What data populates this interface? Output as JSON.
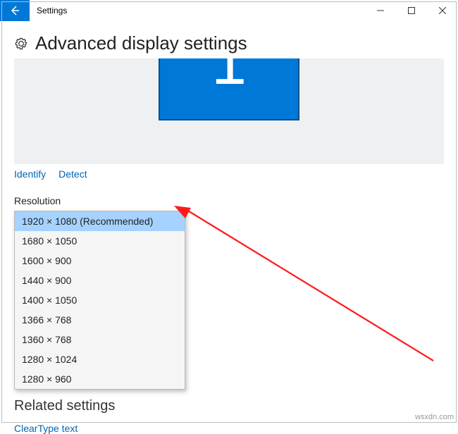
{
  "titlebar": {
    "title": "Settings"
  },
  "page": {
    "heading": "Advanced display settings",
    "monitor_number": "1",
    "identify_label": "Identify",
    "detect_label": "Detect",
    "resolution_label": "Resolution",
    "related_heading": "Related settings",
    "cleartype_label": "ClearType text"
  },
  "resolutions": {
    "items": {
      "0": {
        "label": "1920 × 1080 (Recommended)"
      },
      "1": {
        "label": "1680 × 1050"
      },
      "2": {
        "label": "1600 × 900"
      },
      "3": {
        "label": "1440 × 900"
      },
      "4": {
        "label": "1400 × 1050"
      },
      "5": {
        "label": "1366 × 768"
      },
      "6": {
        "label": "1360 × 768"
      },
      "7": {
        "label": "1280 × 1024"
      },
      "8": {
        "label": "1280 × 960"
      }
    }
  },
  "watermark": "wsxdn.com"
}
